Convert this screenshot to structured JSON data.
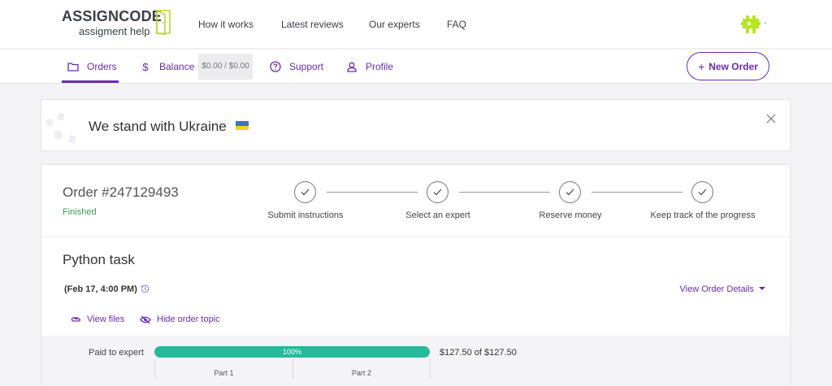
{
  "brand": {
    "logo_line1": "ASSIGNCODE",
    "logo_line2": "assigment help",
    "logo_icon": "door-logo-icon",
    "accent_color": "#6a2bb3"
  },
  "top_nav": {
    "links": [
      "How it works",
      "Latest reviews",
      "Our experts",
      "FAQ"
    ],
    "avatar_icon": "pixel-avatar-icon",
    "avatar_color": "#b8e620",
    "menu_indicator": "-"
  },
  "sub_nav": {
    "orders": {
      "label": "Orders",
      "icon": "folder-icon",
      "active": true
    },
    "balance": {
      "label": "Balance",
      "icon": "dollar-icon",
      "value": "$0.00 / $0.00"
    },
    "support": {
      "label": "Support",
      "icon": "question-circle-icon"
    },
    "profile": {
      "label": "Profile",
      "icon": "user-icon"
    },
    "new_order": {
      "label": "New Order",
      "icon": "plus-icon"
    }
  },
  "banner": {
    "title": "We stand with Ukraine",
    "flag_colors": [
      "#3f72c6",
      "#f5d323"
    ],
    "close_icon": "close-icon"
  },
  "order": {
    "number": "Order #247129493",
    "status": "Finished",
    "status_color": "#3c9a58",
    "steps": [
      {
        "label": "Submit instructions",
        "done": true
      },
      {
        "label": "Select an expert",
        "done": true
      },
      {
        "label": "Reserve money",
        "done": true
      },
      {
        "label": "Keep track of the progress",
        "done": true
      }
    ],
    "title": "Python task",
    "date": "(Feb 17, 4:00 PM)",
    "history_icon": "history-icon",
    "details_link": "View Order Details",
    "view_files": "View files",
    "hide_topic": "Hide order topic",
    "payment": {
      "label": "Paid to expert",
      "progress_text": "100%",
      "progress_fraction": 1.0,
      "progress_color": "#26b99a",
      "amount": "$127.50 of $127.50",
      "parts": [
        "Part 1",
        "Part 2"
      ]
    }
  }
}
